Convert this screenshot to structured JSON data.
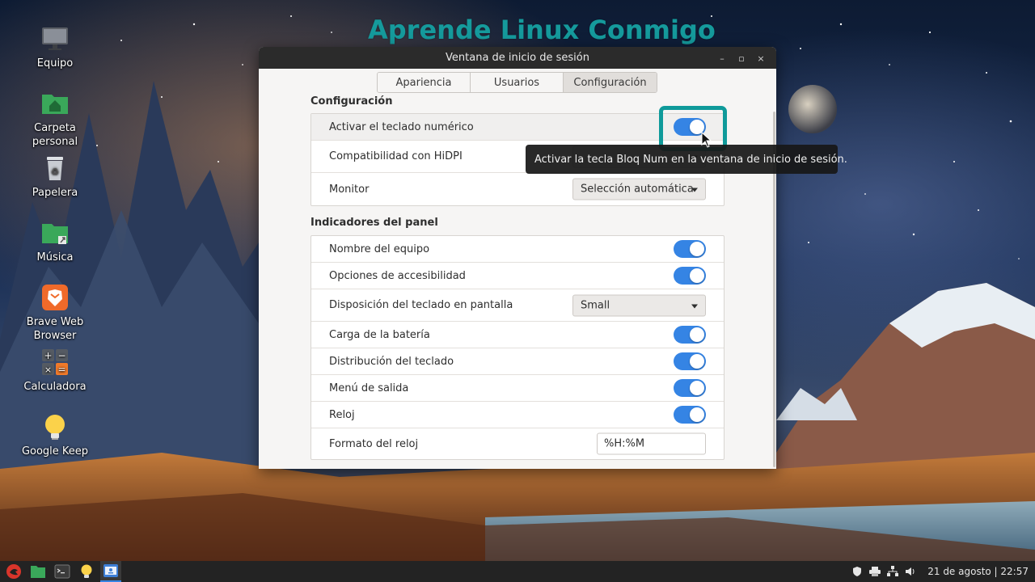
{
  "watermark": "Aprende Linux Conmigo",
  "desktop": {
    "icons": [
      {
        "label": "Equipo",
        "icon": "computer-icon"
      },
      {
        "label": "Carpeta\npersonal",
        "icon": "home-folder-icon"
      },
      {
        "label": "Papelera",
        "icon": "trash-icon"
      },
      {
        "label": "Música",
        "icon": "music-folder-icon"
      },
      {
        "label": "Brave Web\nBrowser",
        "icon": "brave-icon"
      },
      {
        "label": "Calculadora",
        "icon": "calculator-icon"
      },
      {
        "label": "Google Keep",
        "icon": "keep-icon"
      }
    ]
  },
  "window": {
    "title": "Ventana de inicio de sesión",
    "buttons": {
      "minimize": "–",
      "maximize": "▫",
      "close": "×"
    },
    "tabs": [
      {
        "label": "Apariencia",
        "active": false
      },
      {
        "label": "Usuarios",
        "active": false
      },
      {
        "label": "Configuración",
        "active": true
      }
    ],
    "config_section": {
      "title": "Configuración",
      "rows": [
        {
          "label": "Activar el teclado numérico",
          "control": "switch",
          "on": true
        },
        {
          "label": "Compatibilidad con HiDPI",
          "control": "dropdown",
          "value": ""
        },
        {
          "label": "Monitor",
          "control": "dropdown",
          "value": "Selección automática"
        }
      ]
    },
    "panel_section": {
      "title": "Indicadores del panel",
      "rows": [
        {
          "label": "Nombre del equipo",
          "control": "switch",
          "on": true
        },
        {
          "label": "Opciones de accesibilidad",
          "control": "switch",
          "on": true
        },
        {
          "label": "Disposición del teclado en pantalla",
          "control": "dropdown",
          "value": "Small"
        },
        {
          "label": "Carga de la batería",
          "control": "switch",
          "on": true
        },
        {
          "label": "Distribución del teclado",
          "control": "switch",
          "on": true
        },
        {
          "label": "Menú de salida",
          "control": "switch",
          "on": true
        },
        {
          "label": "Reloj",
          "control": "switch",
          "on": true
        },
        {
          "label": "Formato del reloj",
          "control": "text",
          "value": "%H:%M"
        }
      ]
    }
  },
  "tooltip": "Activar la tecla Bloq Num en la ventana de inicio de sesión.",
  "taskbar": {
    "clock": "21 de agosto | 22:57",
    "colors": {
      "accent": "#3584e4",
      "highlight": "#0f9a9a",
      "panel": "#232323"
    }
  }
}
